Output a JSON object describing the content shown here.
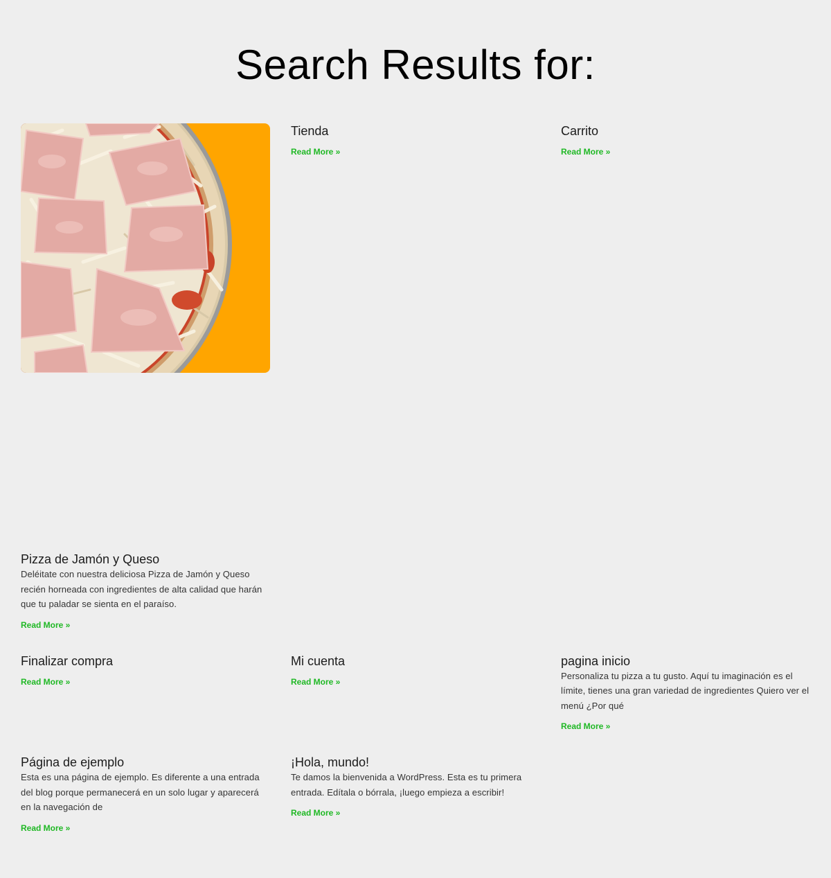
{
  "page": {
    "title": "Search Results for:"
  },
  "colors": {
    "background": "#eeeeee",
    "read_more": "#1fb824",
    "image_backdrop": "#ffa500"
  },
  "results": [
    {
      "title": "Pizza de Jamón y Queso",
      "excerpt": "Deléitate con nuestra deliciosa Pizza de Jamón y Queso recién horneada con ingredientes de alta calidad que harán que tu paladar se sienta en el paraíso.",
      "read_more": "Read More »",
      "has_image": true
    },
    {
      "title": "Tienda",
      "excerpt": "",
      "read_more": "Read More »",
      "has_image": false
    },
    {
      "title": "Carrito",
      "excerpt": "",
      "read_more": "Read More »",
      "has_image": false
    },
    {
      "title": "Finalizar compra",
      "excerpt": "",
      "read_more": "Read More »",
      "has_image": false
    },
    {
      "title": "Mi cuenta",
      "excerpt": "",
      "read_more": "Read More »",
      "has_image": false
    },
    {
      "title": "pagina inicio",
      "excerpt": "Personaliza tu pizza a tu gusto. Aquí tu imaginación es el límite, tienes una gran variedad de ingredientes  Quiero ver el menú ¿Por qué",
      "read_more": "Read More »",
      "has_image": false
    },
    {
      "title": "Página de ejemplo",
      "excerpt": "Esta es una página de ejemplo. Es diferente a una entrada del blog porque permanecerá en un solo lugar y aparecerá en la navegación de",
      "read_more": "Read More »",
      "has_image": false
    },
    {
      "title": "¡Hola, mundo!",
      "excerpt": "Te damos la bienvenida a WordPress. Esta es tu primera entrada. Edítala o bórrala, ¡luego empieza a escribir!",
      "read_more": "Read More »",
      "has_image": false
    }
  ]
}
